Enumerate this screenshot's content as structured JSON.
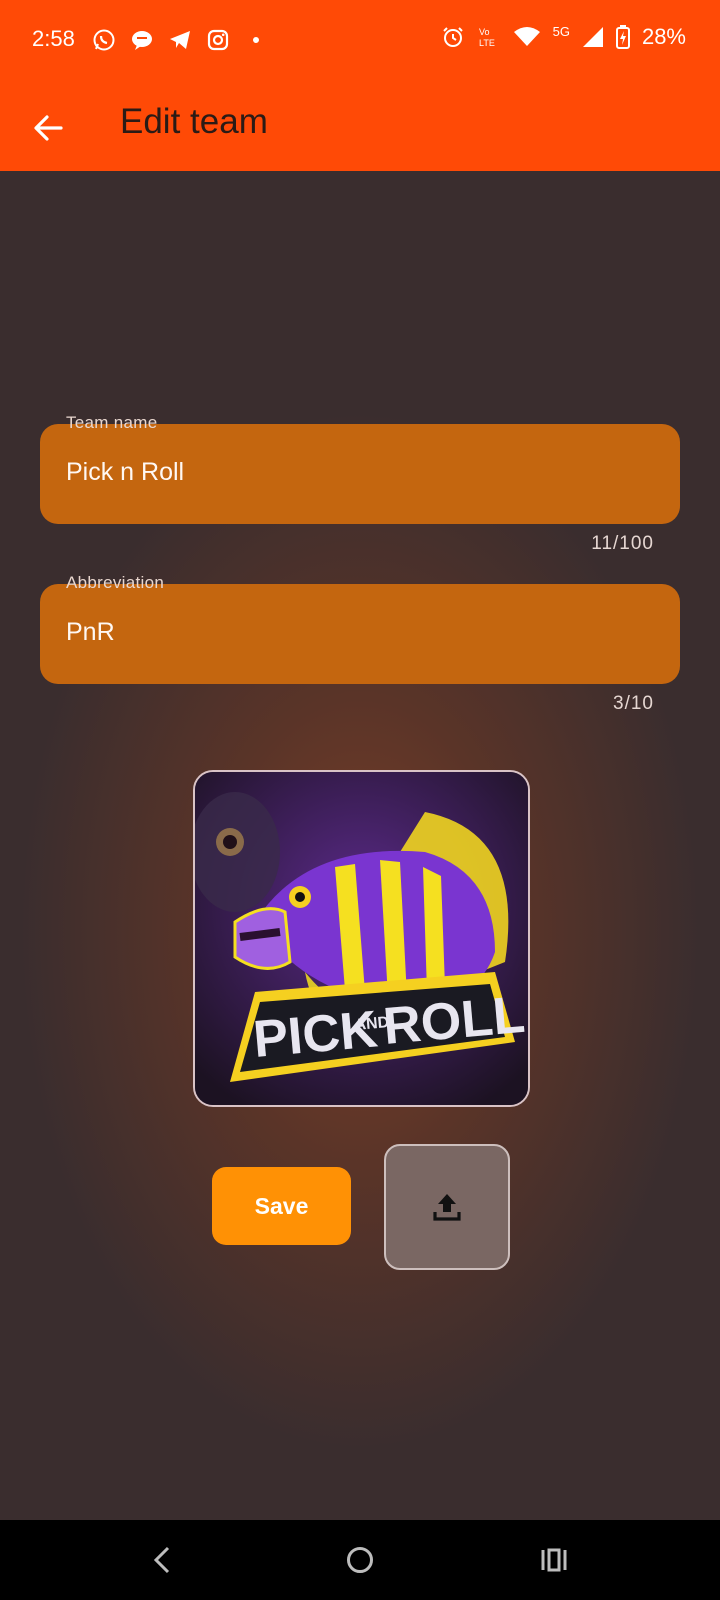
{
  "status_bar": {
    "time": "2:58",
    "battery": "28%",
    "network": "5G",
    "left_icons": [
      "whatsapp-icon",
      "chat-bubble-icon",
      "telegram-icon",
      "instagram-icon",
      "dot-icon"
    ],
    "right_icons": [
      "alarm-icon",
      "volte-icon",
      "wifi-icon",
      "signal-icon",
      "battery-charging-icon"
    ]
  },
  "app_bar": {
    "title": "Edit team",
    "back_icon": "arrow-left-icon"
  },
  "form": {
    "team_name": {
      "label": "Team name",
      "value": "Pick n Roll",
      "counter": "11/100"
    },
    "abbreviation": {
      "label": "Abbreviation",
      "value": "PnR",
      "counter": "3/10"
    }
  },
  "logo": {
    "text_top": "PICK",
    "text_and": "AND",
    "text_bottom": "ROLL"
  },
  "actions": {
    "save_label": "Save",
    "upload_icon": "upload-icon"
  },
  "nav_bar": {
    "icons": [
      "nav-back-icon",
      "nav-home-icon",
      "nav-recents-icon"
    ]
  },
  "colors": {
    "accent": "#ff4a06",
    "field_bg": "#c4660f",
    "save_bg": "#ff9105",
    "background": "#3a2d2e"
  }
}
